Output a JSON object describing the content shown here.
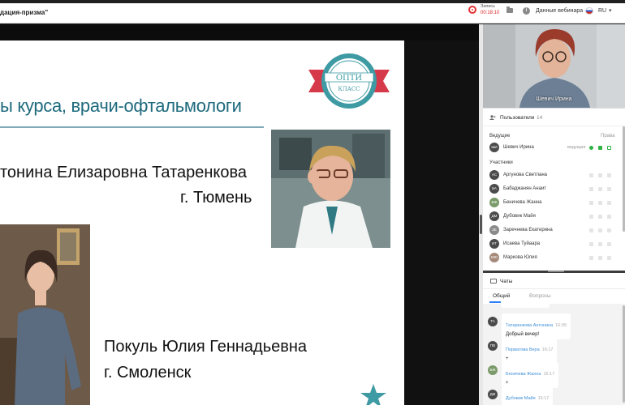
{
  "window": {
    "title": "дация-призма\""
  },
  "topbar": {
    "recording_label": "Запись",
    "recording_time": "00:18:10",
    "webinar_data_label": "Данные вебинара",
    "language": "RU",
    "icons": [
      "record-icon",
      "folder-icon",
      "info-icon",
      "flag-icon",
      "chevron-down-icon"
    ],
    "record_color": "#e23030"
  },
  "slide": {
    "heading": "ы курса, врачи-офтальмологи",
    "heading_color": "#1e6a7d",
    "logo_text_top": "ОПТИ",
    "logo_text_bottom": "КЛАСС",
    "speaker1": {
      "name": "тонина Елизаровна Татаренкова",
      "city": "г. Тюмень"
    },
    "speaker2": {
      "name": "Покуль Юлия Геннадьевна",
      "city": "г. Смоленск"
    }
  },
  "video": {
    "presenter_name": "Шевич Ирина"
  },
  "users": {
    "title": "Пользователи",
    "count": "14",
    "hosts_label": "Ведущие",
    "rights_label": "Права",
    "participants_label": "Участники",
    "hosts": [
      {
        "initials": "ШИ",
        "name": "Шевич Ирина",
        "role": "ведущая"
      }
    ],
    "participants": [
      {
        "initials": "АС",
        "name": "Аргунова Светлана"
      },
      {
        "initials": "БА",
        "name": "Бабаджанян Анаит"
      },
      {
        "initials": "БЖ",
        "name": "Беничева Жанна"
      },
      {
        "initials": "ДМ",
        "name": "Дубовик Майя"
      },
      {
        "initials": "ЗЕ",
        "name": "Заречнева Екатерина"
      },
      {
        "initials": "ИТ",
        "name": "Исаева Туйаара"
      },
      {
        "initials": "МЮ",
        "name": "Маркова Юлия"
      }
    ]
  },
  "chat": {
    "title": "Чаты",
    "tabs": [
      "Общий",
      "Вопросы"
    ],
    "active_tab": "Общий",
    "messages": [
      {
        "initials": "ТА",
        "author": "Татаренкова Антонина",
        "time": "16:09",
        "text": "Добрый вечер!"
      },
      {
        "initials": "ПВ",
        "author": "Порватова Вера",
        "time": "16:17",
        "text": "+"
      },
      {
        "initials": "БЖ",
        "author": "Беничева Жанна",
        "time": "16:17",
        "text": "+"
      },
      {
        "initials": "ДМ",
        "author": "Дубовик Майя",
        "time": "16:17",
        "text": "+"
      }
    ]
  }
}
